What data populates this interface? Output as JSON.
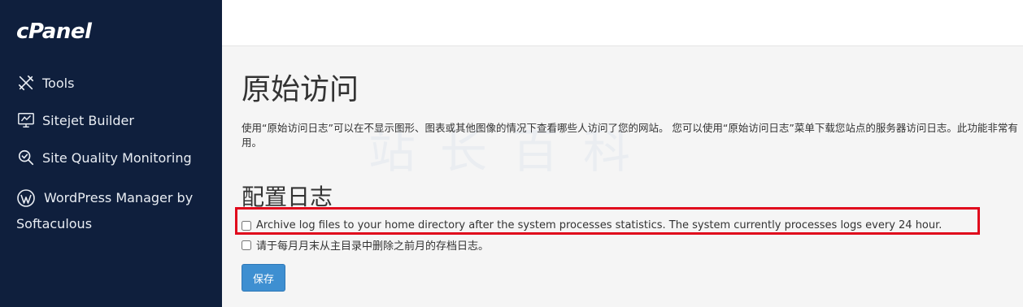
{
  "sidebar": {
    "logo": "cPanel",
    "items": [
      {
        "label": "Tools",
        "icon": "tools-icon"
      },
      {
        "label": "Sitejet Builder",
        "icon": "monitor-icon"
      },
      {
        "label": "Site Quality Monitoring",
        "icon": "magnifier-check-icon"
      },
      {
        "label": "WordPress Manager by",
        "label2": "Softaculous",
        "icon": "wordpress-icon"
      }
    ]
  },
  "main": {
    "title": "原始访问",
    "description": "使用“原始访问日志”可以在不显示图形、图表或其他图像的情况下查看哪些人访问了您的网站。 您可以使用“原始访问日志”菜单下载您站点的服务器访问日志。此功能非常有用。",
    "watermark": "站长百科",
    "config_title": "配置日志",
    "options": [
      {
        "label": "Archive log files to your home directory after the system processes statistics. The system currently processes logs every 24 hour.",
        "checked": false
      },
      {
        "label": "请于每月月末从主目录中删除之前月的存档日志。",
        "checked": false
      }
    ],
    "save_label": "保存"
  },
  "colors": {
    "sidebar_bg": "#0f1f3d",
    "primary_button": "#3e8fd1",
    "highlight_border": "#e0081c"
  }
}
